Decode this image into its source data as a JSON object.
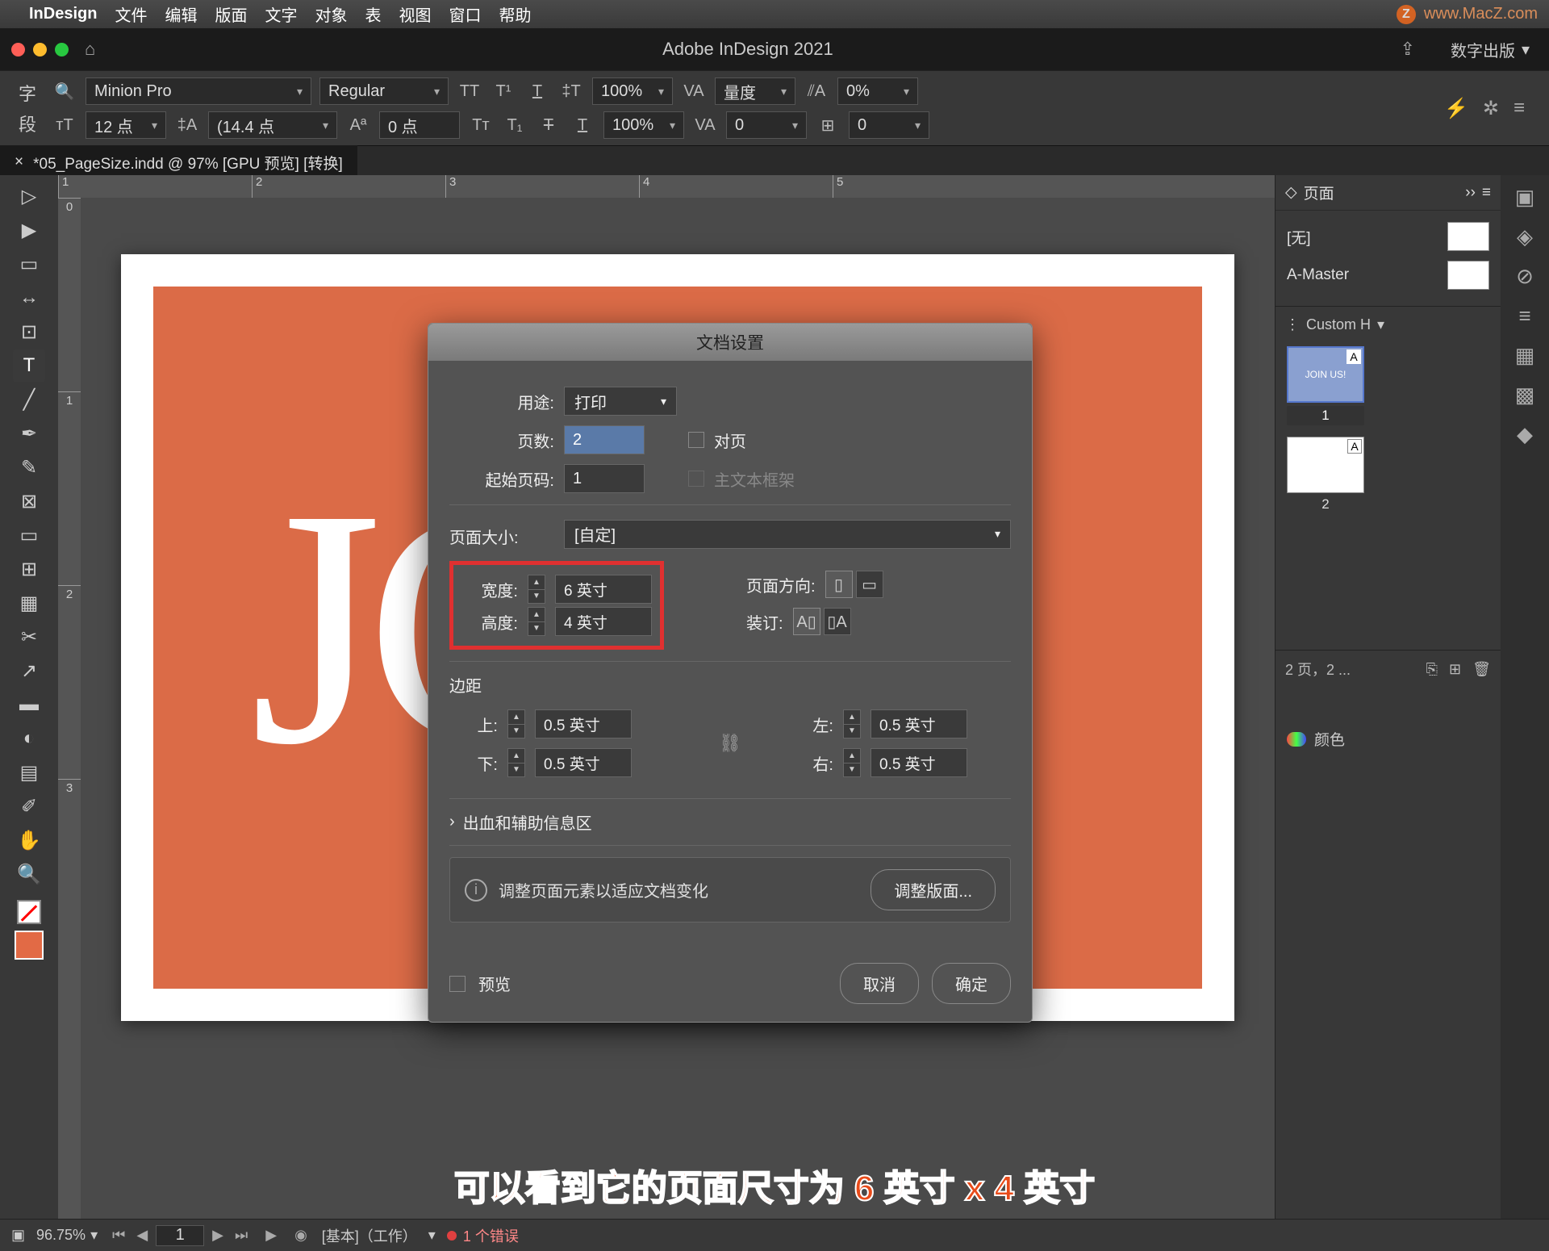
{
  "menubar": {
    "app": "InDesign",
    "items": [
      "文件",
      "编辑",
      "版面",
      "文字",
      "对象",
      "表",
      "视图",
      "窗口",
      "帮助"
    ],
    "watermark": "www.MacZ.com"
  },
  "titlebar": {
    "title": "Adobe InDesign 2021",
    "publish": "数字出版"
  },
  "controlbar": {
    "char": "字",
    "para": "段",
    "font": "Minion Pro",
    "style": "Regular",
    "size": "12 点",
    "leading": "(14.4 点",
    "baseline": "0 点",
    "scale1": "100%",
    "scale2": "100%",
    "tracking": "量度",
    "kerning": "0",
    "opt1": "0%",
    "opt2": "0"
  },
  "doctab": {
    "name": "*05_PageSize.indd @ 97% [GPU 预览] [转换]"
  },
  "ruler_h": [
    "1",
    "2",
    "3",
    "4",
    "5"
  ],
  "ruler_v": [
    "0",
    "1",
    "2",
    "3"
  ],
  "canvas_text": "JC",
  "pages_panel": {
    "title": "页面",
    "none": "[无]",
    "master": "A-Master",
    "spread": "Custom H",
    "thumb1_text": "JOIN US!",
    "pg1": "1",
    "pg2": "2",
    "footer": "2 页，2 ..."
  },
  "color_panel": "颜色",
  "dialog": {
    "title": "文档设置",
    "intent_label": "用途:",
    "intent_value": "打印",
    "pages_label": "页数:",
    "pages_value": "2",
    "facing": "对页",
    "start_label": "起始页码:",
    "start_value": "1",
    "primary_tf": "主文本框架",
    "pagesize_label": "页面大小:",
    "pagesize_value": "[自定]",
    "width_label": "宽度:",
    "width_value": "6 英寸",
    "height_label": "高度:",
    "height_value": "4 英寸",
    "orient_label": "页面方向:",
    "bind_label": "装订:",
    "margins_label": "边距",
    "top_label": "上:",
    "bottom_label": "下:",
    "left_label": "左:",
    "right_label": "右:",
    "margin_val": "0.5 英寸",
    "bleed_section": "出血和辅助信息区",
    "adjust_msg": "调整页面元素以适应文档变化",
    "adjust_btn": "调整版面...",
    "preview": "预览",
    "cancel": "取消",
    "ok": "确定"
  },
  "statusbar": {
    "zoom": "96.75%",
    "page": "1",
    "profile": "[基本]（工作）",
    "errors": "1 个错误"
  },
  "annotation": "可以看到它的页面尺寸为 6 英寸 x 4 英寸"
}
